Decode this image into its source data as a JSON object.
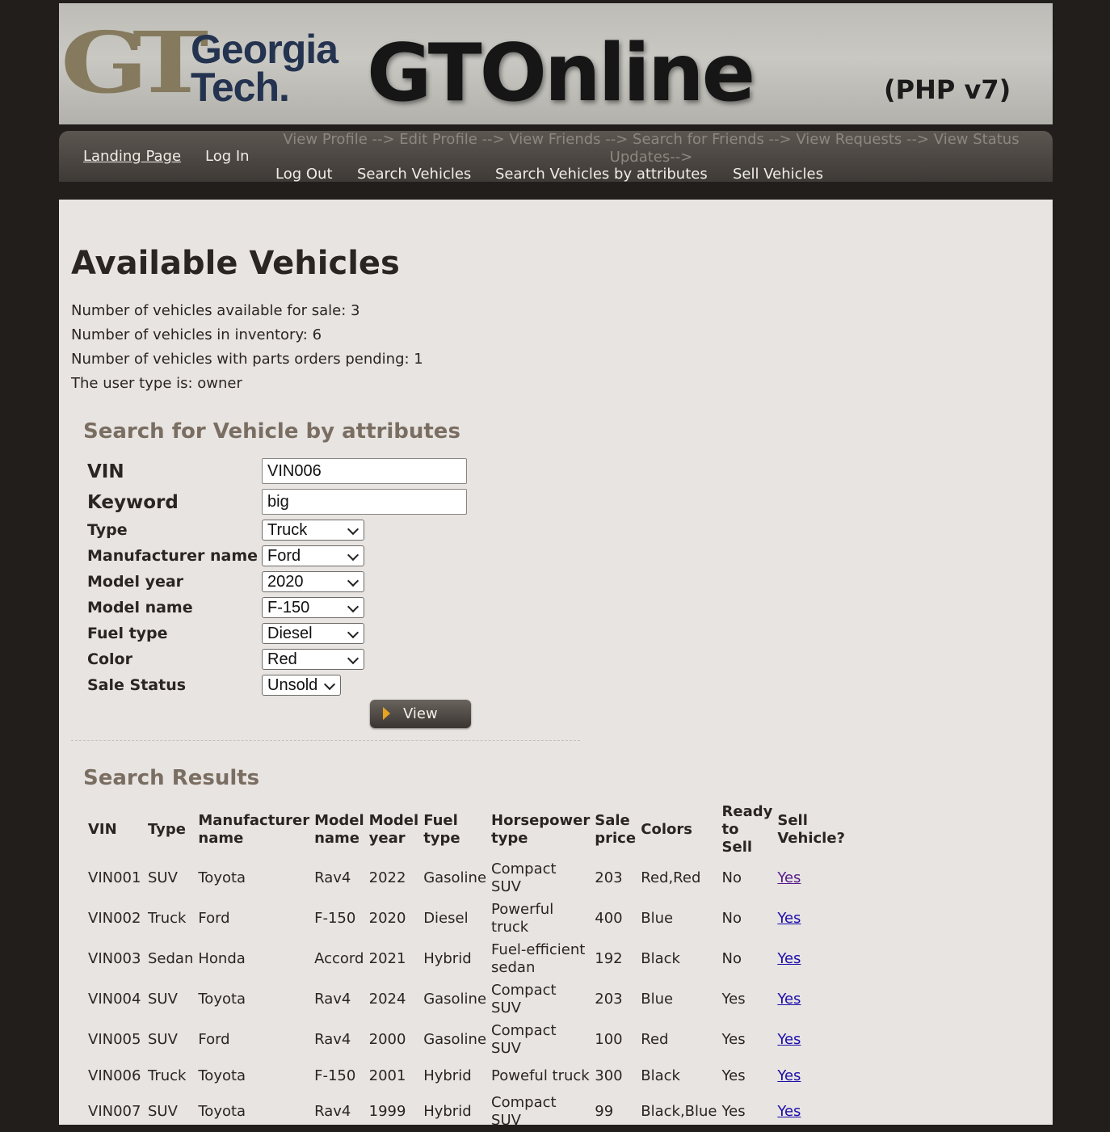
{
  "banner": {
    "gt_monogram": "GT",
    "institution_line1": "Georgia",
    "institution_line2": "Tech.",
    "site_title": "GTOnline",
    "version": "(PHP v7)"
  },
  "nav": {
    "landing": "Landing Page",
    "login": "Log In",
    "faded_links": "View Profile --> Edit Profile --> View Friends --> Search for Friends --> View Requests --> View Status Updates-->",
    "logout": "Log Out",
    "search_vehicles": "Search Vehicles",
    "search_by_attributes": "Search Vehicles by attributes",
    "sell_vehicles": "Sell Vehicles"
  },
  "page": {
    "title": "Available Vehicles",
    "stats": [
      "Number of vehicles available for sale: 3",
      "Number of vehicles in inventory: 6",
      "Number of vehicles with parts orders pending: 1",
      "The user type is: owner"
    ]
  },
  "search": {
    "title": "Search for Vehicle by attributes",
    "vin_label": "VIN",
    "vin_value": "VIN006",
    "keyword_label": "Keyword",
    "keyword_value": "big",
    "type_label": "Type",
    "type_value": "Truck",
    "manufacturer_label": "Manufacturer name",
    "manufacturer_value": "Ford",
    "model_year_label": "Model year",
    "model_year_value": "2020",
    "model_name_label": "Model name",
    "model_name_value": "F-150",
    "fuel_label": "Fuel type",
    "fuel_value": "Diesel",
    "color_label": "Color",
    "color_value": "Red",
    "status_label": "Sale Status",
    "status_value": "Unsold",
    "view_button": "View"
  },
  "results": {
    "title": "Search Results",
    "headers": [
      "VIN",
      "Type",
      "Manufacturer name",
      "Model name",
      "Model year",
      "Fuel type",
      "Horsepower type",
      "Sale price",
      "Colors",
      "Ready to Sell",
      "Sell Vehicle?"
    ],
    "rows": [
      [
        "VIN001",
        "SUV",
        "Toyota",
        "Rav4",
        "2022",
        "Gasoline",
        "Compact SUV",
        "203",
        "Red,Red",
        "No",
        "Yes"
      ],
      [
        "VIN002",
        "Truck",
        "Ford",
        "F-150",
        "2020",
        "Diesel",
        "Powerful truck",
        "400",
        "Blue",
        "No",
        "Yes"
      ],
      [
        "VIN003",
        "Sedan",
        "Honda",
        "Accord",
        "2021",
        "Hybrid",
        "Fuel-efficient sedan",
        "192",
        "Black",
        "No",
        "Yes"
      ],
      [
        "VIN004",
        "SUV",
        "Toyota",
        "Rav4",
        "2024",
        "Gasoline",
        "Compact SUV",
        "203",
        "Blue",
        "Yes",
        "Yes"
      ],
      [
        "VIN005",
        "SUV",
        "Ford",
        "Rav4",
        "2000",
        "Gasoline",
        "Compact SUV",
        "100",
        "Red",
        "Yes",
        "Yes"
      ],
      [
        "VIN006",
        "Truck",
        "Toyota",
        "F-150",
        "2001",
        "Hybrid",
        "Poweful truck",
        "300",
        "Black",
        "Yes",
        "Yes"
      ],
      [
        "VIN007",
        "SUV",
        "Toyota",
        "Rav4",
        "1999",
        "Hybrid",
        "Compact SUV",
        "99",
        "Black,Blue",
        "Yes",
        "Yes"
      ]
    ]
  }
}
